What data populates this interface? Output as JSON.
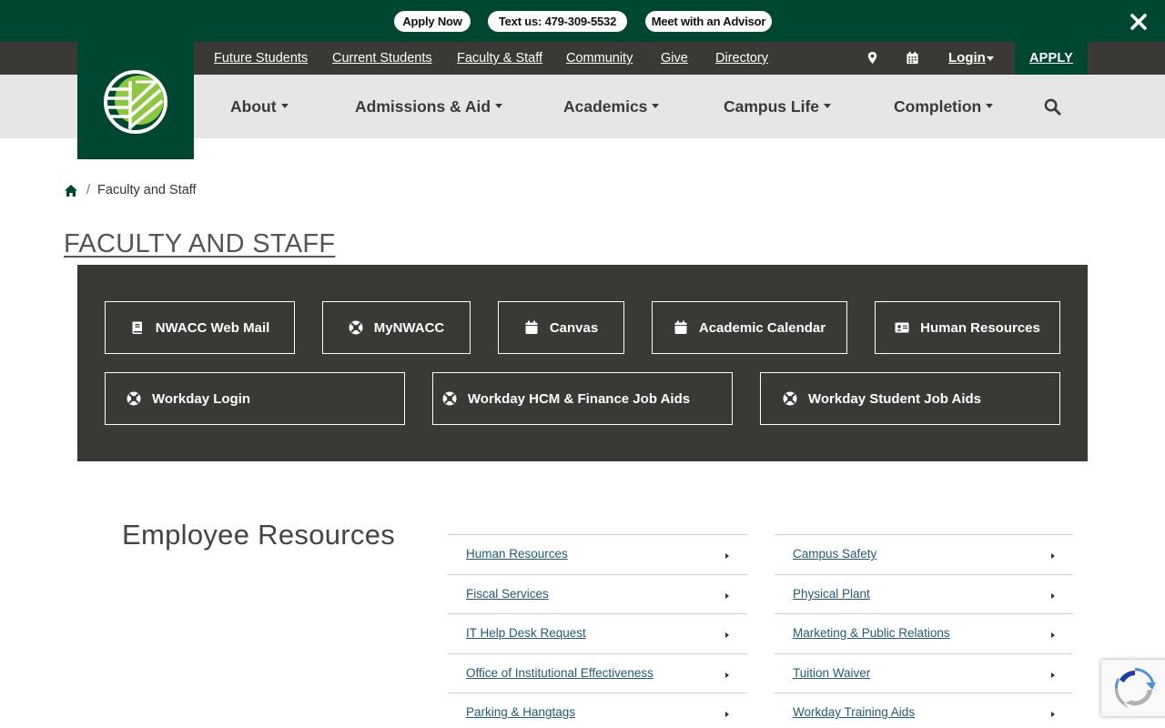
{
  "alert_bar": {
    "buttons": [
      "Apply Now",
      "Text us: 479-309-5532",
      "Meet with an Advisor"
    ],
    "close_icon": "close-x-icon"
  },
  "utility_nav": {
    "links": [
      "Future Students",
      "Current Students",
      "Faculty & Staff",
      "Community",
      "Give",
      "Directory"
    ],
    "icons": [
      "map-pin-icon",
      "calendar-icon"
    ],
    "login": "Login",
    "apply": "APPLY"
  },
  "main_nav": {
    "items": [
      "About",
      "Admissions & Aid",
      "Academics",
      "Campus Life",
      "Completion"
    ],
    "search_icon": "search-icon"
  },
  "brand": {
    "primary": "#004731",
    "dark": "#3b3936",
    "light_gray": "#e6e6e6",
    "logo_accent": "#8dc63f"
  },
  "breadcrumb": {
    "home_icon": "home-icon",
    "current": "Faculty and Staff"
  },
  "page_title": "FACULTY AND STAFF",
  "quick_links": [
    {
      "label": "NWACC Web Mail",
      "icon": "book-icon"
    },
    {
      "label": "MyNWACC",
      "icon": "life-ring-icon"
    },
    {
      "label": "Canvas",
      "icon": "calendar-icon"
    },
    {
      "label": "Academic Calendar",
      "icon": "calendar-icon"
    },
    {
      "label": "Human Resources",
      "icon": "id-card-icon"
    },
    {
      "label": "Workday Login",
      "icon": "life-ring-icon"
    },
    {
      "label": "Workday HCM & Finance Job Aids",
      "icon": "life-ring-icon"
    },
    {
      "label": "Workday Student Job Aids",
      "icon": "life-ring-icon"
    }
  ],
  "employee_resources": {
    "heading": "Employee Resources",
    "col1": [
      "Human Resources",
      "Fiscal Services",
      "IT Help Desk Request",
      "Office of Institutional Effectiveness",
      "Parking & Hangtags"
    ],
    "col2": [
      "Campus Safety",
      "Physical Plant",
      "Marketing & Public Relations",
      "Tuition Waiver",
      "Workday Training Aids"
    ]
  },
  "recaptcha_icon": "recaptcha-icon"
}
